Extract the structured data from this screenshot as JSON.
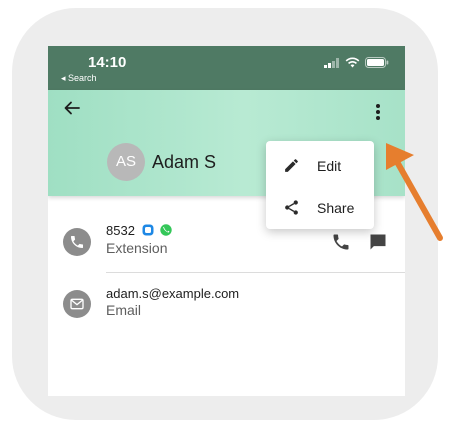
{
  "status_bar": {
    "time": "14:10",
    "back_label": "◂ Search"
  },
  "header": {
    "back_icon": "arrow-left-icon",
    "menu_icon": "more-vertical-icon"
  },
  "contact": {
    "initials": "AS",
    "name": "Adam S"
  },
  "extension_row": {
    "number": "8532",
    "label": "Extension"
  },
  "email_row": {
    "address": "adam.s@example.com",
    "label": "Email"
  },
  "menu": {
    "items": [
      {
        "label": "Edit",
        "icon": "pencil-icon"
      },
      {
        "label": "Share",
        "icon": "share-icon"
      }
    ]
  },
  "colors": {
    "status_bar": "#4f7a64",
    "header": "#a7e2c8",
    "annotation_arrow": "#e67e2e",
    "chat_badge": "#1e88e5",
    "call_badge": "#34c759"
  }
}
